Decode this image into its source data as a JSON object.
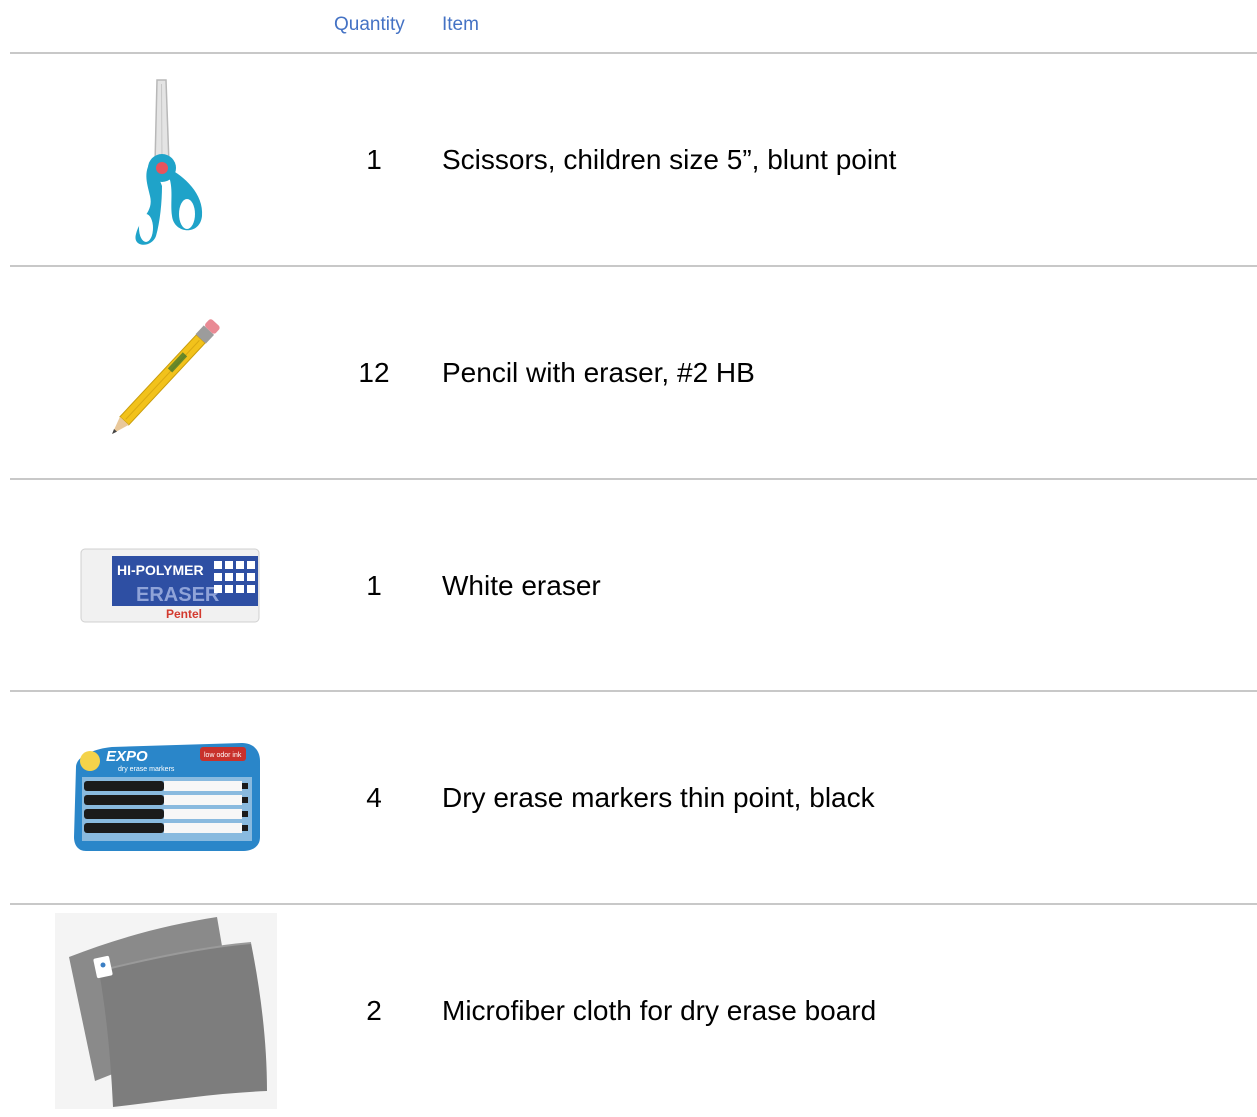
{
  "header": {
    "quantity_label": "Quantity",
    "item_label": "Item"
  },
  "rows": [
    {
      "quantity": "1",
      "item": "Scissors, children size 5”, blunt point",
      "icon": "scissors-icon"
    },
    {
      "quantity": "12",
      "item": "Pencil with eraser, #2 HB",
      "icon": "pencil-icon"
    },
    {
      "quantity": "1",
      "item": "White eraser",
      "icon": "eraser-icon",
      "eraser_brand": "HI-POLYMER",
      "eraser_word": "ERASER",
      "eraser_maker": "Pentel"
    },
    {
      "quantity": "4",
      "item": "Dry erase markers thin point, black",
      "icon": "markers-icon",
      "marker_brand": "EXPO",
      "marker_sub": "dry erase markers",
      "marker_tag": "low odor ink"
    },
    {
      "quantity": "2",
      "item": "Microfiber cloth for dry erase board",
      "icon": "cloth-icon"
    }
  ],
  "colors": {
    "header_text": "#4472c4",
    "rule": "#c8c8c8",
    "scissors": "#1fa3c9",
    "pencil": "#f2c21b",
    "cloth": "#7d7d7d",
    "eraser_band": "#2e4fa3"
  }
}
